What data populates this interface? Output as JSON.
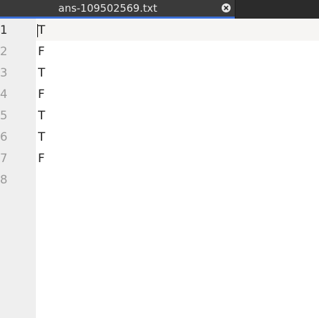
{
  "tab": {
    "title": "ans-109502569.txt",
    "close_icon": "close-icon",
    "accent_color": "#3b6fd8"
  },
  "editor": {
    "line_numbers": [
      "1",
      "2",
      "3",
      "4",
      "5",
      "6",
      "7",
      "8"
    ],
    "lines": [
      "T",
      "F",
      "T",
      "F",
      "T",
      "T",
      "F",
      ""
    ],
    "current_line": 1
  }
}
